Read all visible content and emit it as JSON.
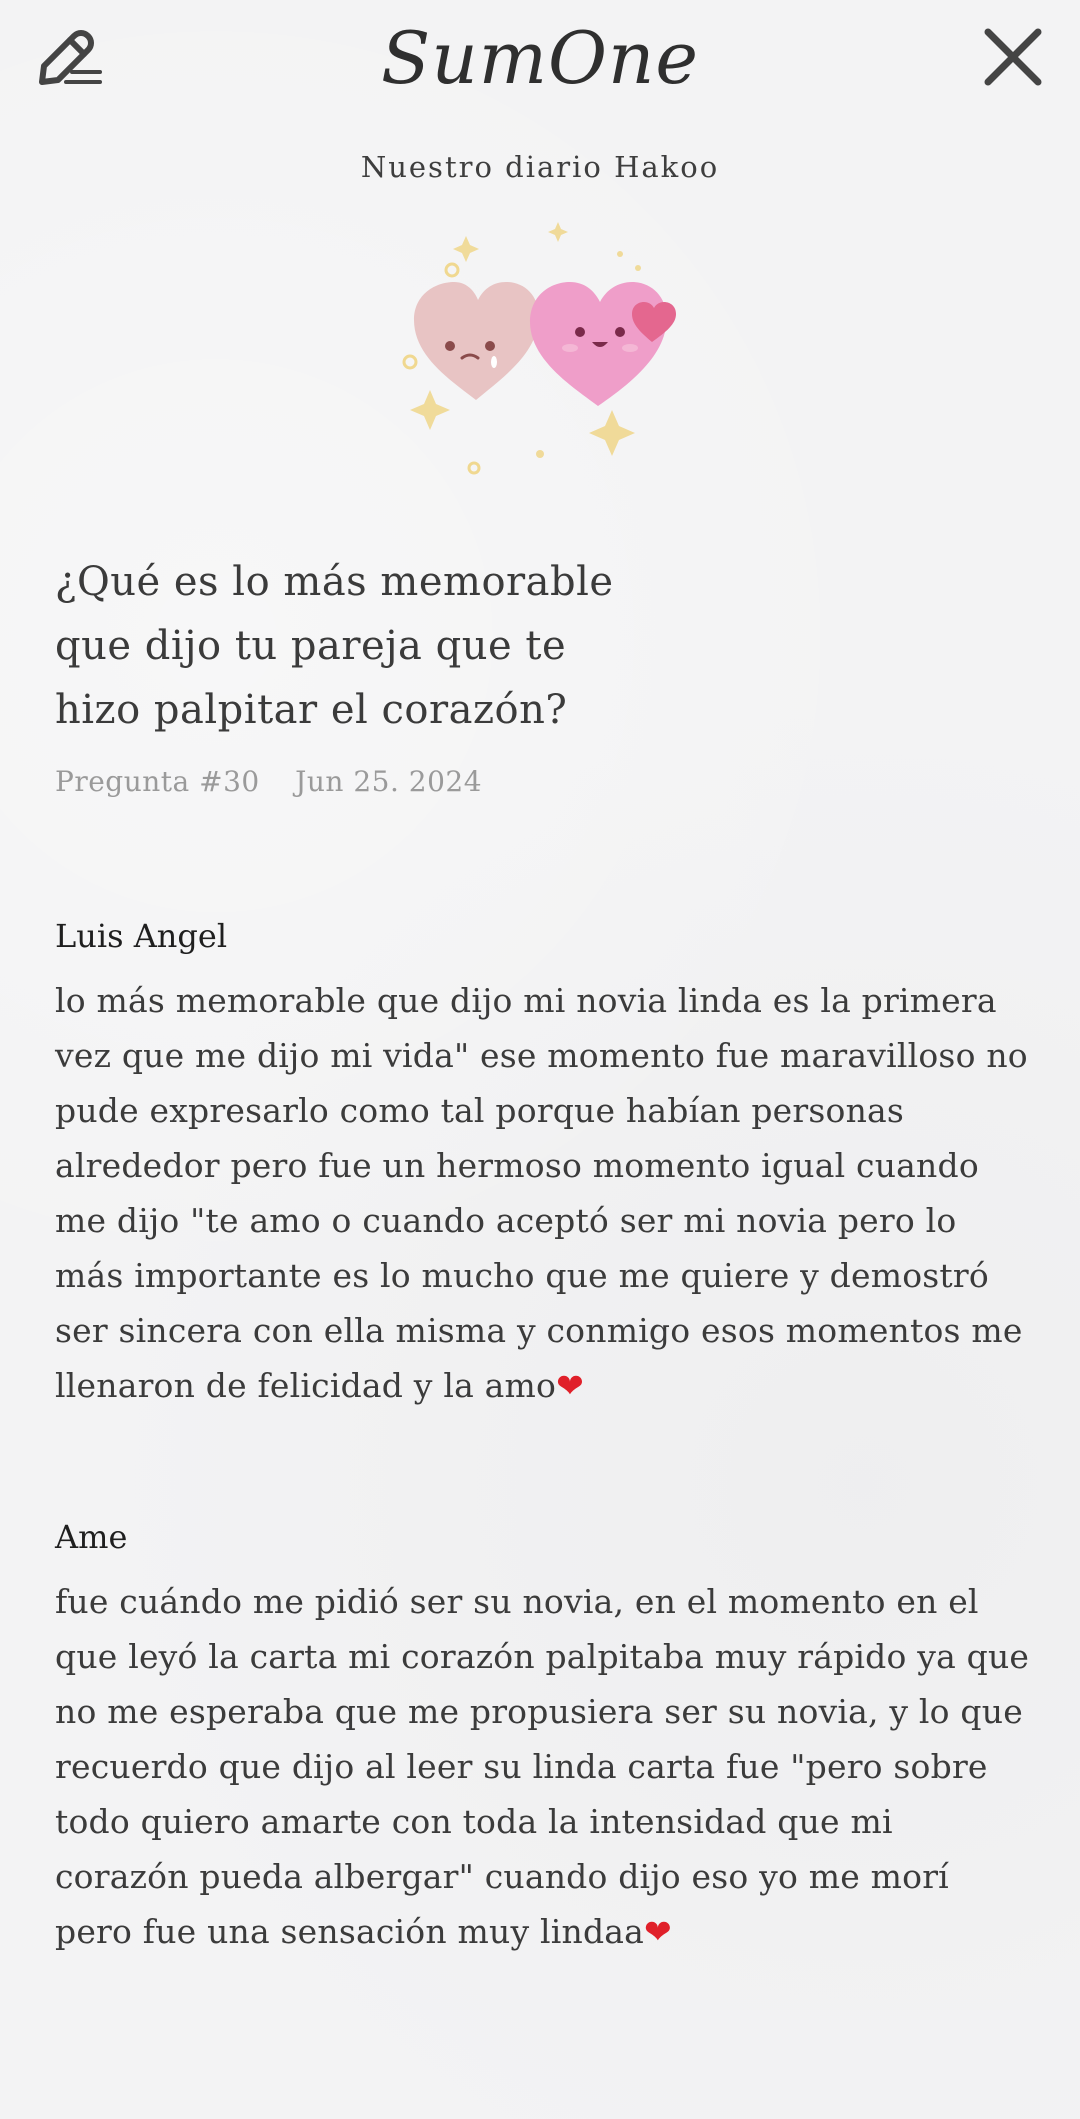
{
  "header": {
    "app_name": "SumOne",
    "edit_icon": "pencil-note-icon",
    "close_icon": "close-icon"
  },
  "diary_title": "Nuestro diario Hakoo",
  "illustration": {
    "name": "two-hearts-illustration"
  },
  "question": {
    "line1": "¿Qué es lo más memorable",
    "line2": "que dijo tu pareja que te",
    "line3": "hizo palpitar el corazón?",
    "number": "Pregunta #30",
    "date": "Jun 25. 2024"
  },
  "answers": [
    {
      "author": "Luis Angel",
      "text": "lo más memorable que dijo mi novia linda es la primera vez que me dijo mi vida\" ese momento fue maravilloso no pude expresarlo como tal porque habían personas alrededor pero fue un hermoso momento igual cuando me dijo \"te amo o cuando aceptó ser mi novia pero lo más importante es lo mucho que me quiere y demostró ser sincera con ella misma y conmigo esos momentos me llenaron de felicidad y la amo",
      "emoji": "❤"
    },
    {
      "author": "Ame",
      "text": "fue cuándo me pidió ser su novia, en el momento en el que leyó la carta mi corazón palpitaba muy rápido ya que no me esperaba que me propusiera ser su novia, y  lo que recuerdo que dijo al leer su linda carta fue \"pero sobre todo quiero amarte con toda la intensidad que mi corazón pueda albergar\" cuando dijo eso yo me morí pero fue una sensación muy lindaa",
      "emoji": "❤"
    }
  ],
  "colors": {
    "background": "#f3f3f4",
    "text": "#3b3b3b",
    "meta": "#9a9a9a",
    "heart_red": "#e0202a",
    "heart_pink": "#ef9ec9",
    "heart_light": "#e8c4c4"
  }
}
